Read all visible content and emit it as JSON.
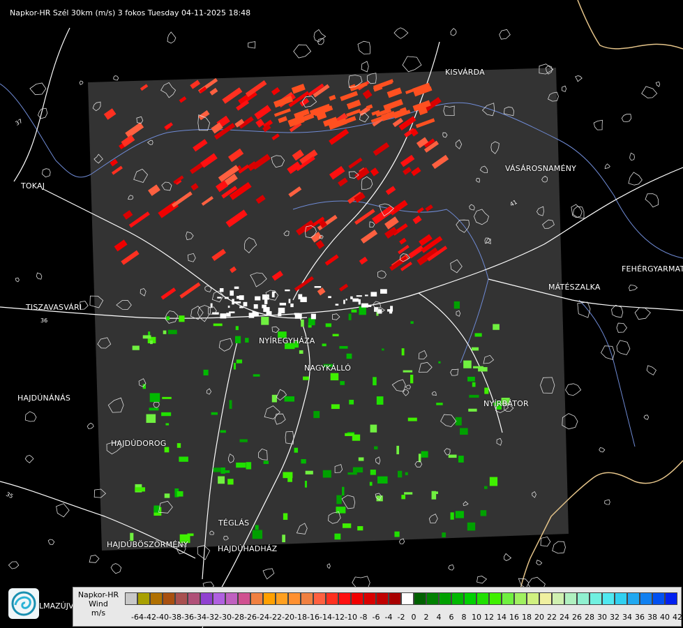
{
  "header": {
    "title": "Napkor-HR Szél 30km (m/s) 3 fokos Tuesday 04-11-2025 18:48"
  },
  "colors": {
    "background": "#000000",
    "radar_area": "#333333",
    "roads": "#ffffff",
    "rivers": "#6f8bd6",
    "border": "#e6c58a"
  },
  "map": {
    "cities": [
      {
        "name": "KISVÁRDA"
      },
      {
        "name": "TOKAJ"
      },
      {
        "name": "VÁSÁROSNAMÉNY"
      },
      {
        "name": "FEHÉRGYARMAT"
      },
      {
        "name": "MÁTÉSZALKA"
      },
      {
        "name": "TISZAVASVÁRI"
      },
      {
        "name": "NYÍREGYHÁZA"
      },
      {
        "name": "NAGYKÁLLÓ"
      },
      {
        "name": "HAJDÚNÁNÁS"
      },
      {
        "name": "NYÍRBÁTOR"
      },
      {
        "name": "HAJDÚDOROG"
      },
      {
        "name": "TÉGLÁS"
      },
      {
        "name": "HAJDÚBÖSZÖRMÉNY"
      },
      {
        "name": "HAJDÚHADHÁZ"
      }
    ],
    "road_numbers": [
      "41",
      "36",
      "35",
      "37"
    ]
  },
  "footer": {
    "logo_icon": "swirl-logo-icon",
    "partial_label": "LMAZÚJVÁR"
  },
  "legend": {
    "title_lines": [
      "Napkor-HR",
      "Wind",
      "m/s"
    ],
    "ticks": [
      "-64",
      "-42",
      "-40",
      "-38",
      "-36",
      "-34",
      "-32",
      "-30",
      "-28",
      "-26",
      "-24",
      "-22",
      "-20",
      "-18",
      "-16",
      "-14",
      "-12",
      "-10",
      "-8",
      "-6",
      "-4",
      "-2",
      "0",
      "2",
      "4",
      "6",
      "8",
      "10",
      "12",
      "14",
      "16",
      "18",
      "20",
      "22",
      "24",
      "26",
      "28",
      "30",
      "32",
      "34",
      "36",
      "38",
      "40",
      "42"
    ],
    "colors": [
      "#c8c8c8",
      "#a8a000",
      "#b07000",
      "#a85010",
      "#a85050",
      "#b05078",
      "#9040d0",
      "#b060e0",
      "#c060c0",
      "#d05090",
      "#f08040",
      "#ffa000",
      "#ffa020",
      "#ff9030",
      "#f08040",
      "#ff6040",
      "#ff3020",
      "#ff1010",
      "#f00000",
      "#d80000",
      "#c00000",
      "#a80000",
      "#ffffff",
      "#006000",
      "#008000",
      "#00a000",
      "#00b800",
      "#00d000",
      "#20e000",
      "#40f000",
      "#70f040",
      "#a0f060",
      "#d0f080",
      "#f0f0a0",
      "#d0f0b0",
      "#b0f0c0",
      "#90f0d0",
      "#70f0e0",
      "#50e8f0",
      "#30d0f0",
      "#20a8f0",
      "#1080f0",
      "#0050f0",
      "#0020f0"
    ]
  }
}
